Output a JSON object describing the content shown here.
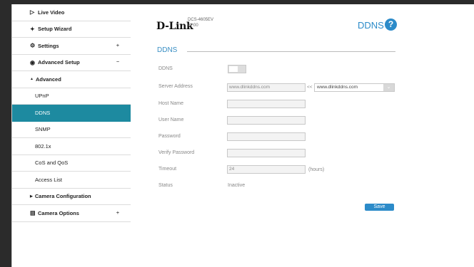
{
  "header": {
    "brand": "D-Link",
    "model": "DCS-4605EV",
    "version": "v1.00",
    "page_title": "DDNS",
    "help_label": "?"
  },
  "sidebar": {
    "items": [
      {
        "label": "Live Video",
        "icon": "video-icon"
      },
      {
        "label": "Setup Wizard",
        "icon": "wand-icon"
      },
      {
        "label": "Settings",
        "icon": "gear-icon",
        "toggle": "+"
      },
      {
        "label": "Advanced Setup",
        "icon": "advanced-icon",
        "toggle": "−"
      },
      {
        "label": "Advanced",
        "caret": "▲"
      },
      {
        "label": "UPnP"
      },
      {
        "label": "DDNS",
        "active": true
      },
      {
        "label": "SNMP"
      },
      {
        "label": "802.1x"
      },
      {
        "label": "CoS and QoS"
      },
      {
        "label": "Access List"
      },
      {
        "label": "Camera Configuration",
        "caret": "▶"
      },
      {
        "label": "Camera Options",
        "icon": "file-icon",
        "toggle": "+"
      }
    ]
  },
  "form": {
    "section_title": "DDNS",
    "ddns_label": "DDNS",
    "ddns_enabled": false,
    "server_address_label": "Server Address",
    "server_address_value": "www.dlinkddns.com",
    "server_arrows": "<<",
    "server_select_value": "www.dlinkddns.com",
    "host_name_label": "Host Name",
    "user_name_label": "User Name",
    "password_label": "Password",
    "verify_password_label": "Verify Password",
    "timeout_label": "Timeout",
    "timeout_value": "24",
    "timeout_unit": "(hours)",
    "status_label": "Status",
    "status_value": "Inactive",
    "save_label": "Save"
  },
  "colors": {
    "accent": "#2c8bc9",
    "active_nav": "#1d8aa0"
  }
}
